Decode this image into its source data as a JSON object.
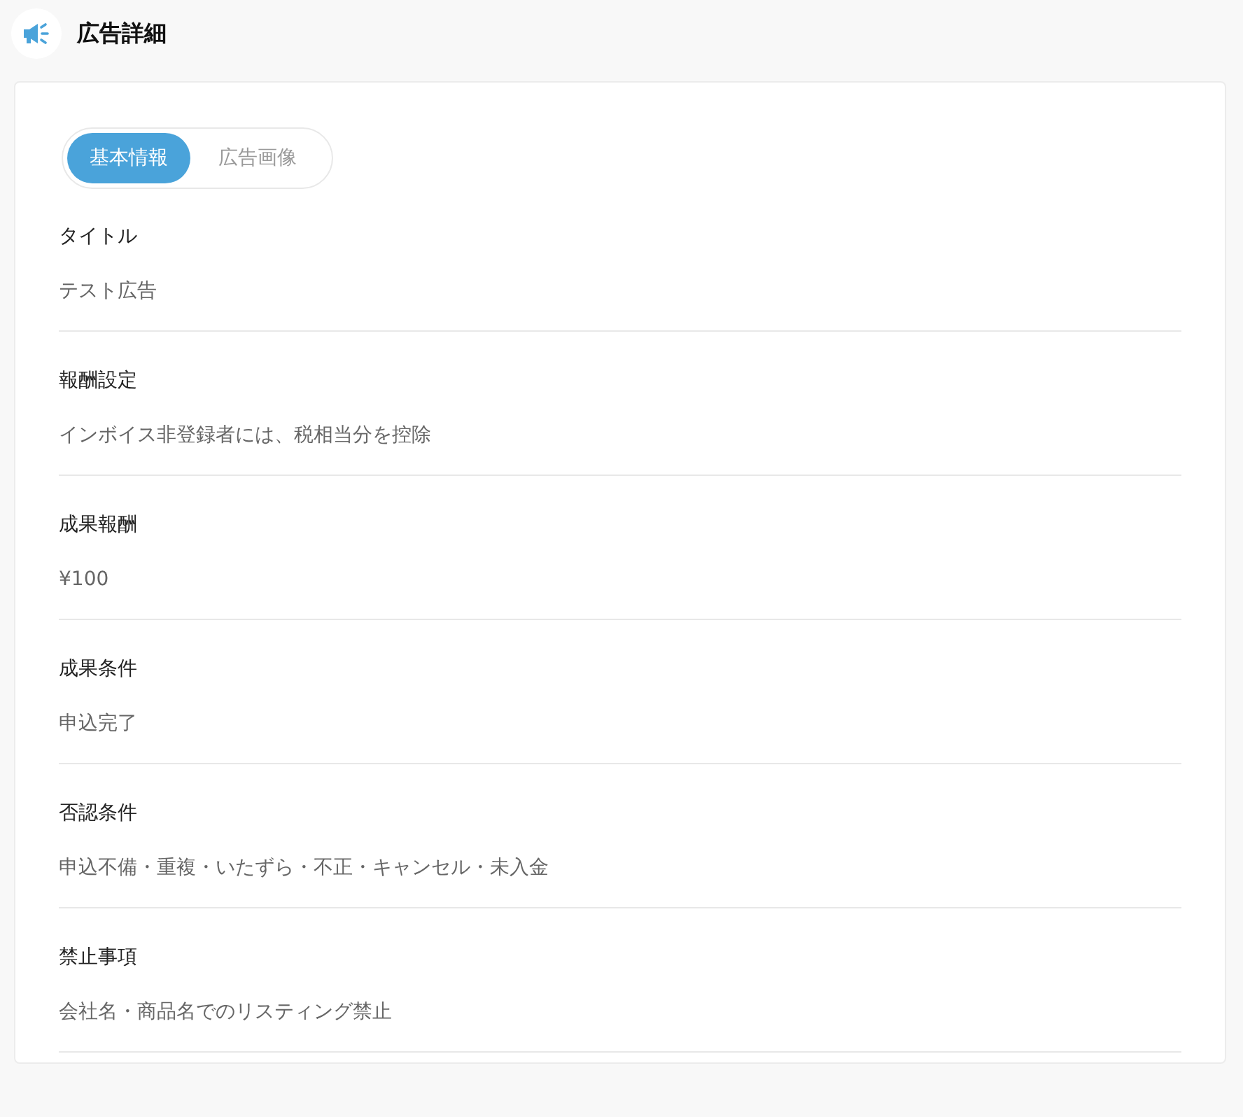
{
  "header": {
    "title": "広告詳細"
  },
  "tabs": [
    {
      "label": "基本情報",
      "selected": true
    },
    {
      "label": "広告画像",
      "selected": false
    }
  ],
  "fields": [
    {
      "label": "タイトル",
      "value": "テスト広告"
    },
    {
      "label": "報酬設定",
      "value": "インボイス非登録者には、税相当分を控除"
    },
    {
      "label": "成果報酬",
      "value": "¥100"
    },
    {
      "label": "成果条件",
      "value": "申込完了"
    },
    {
      "label": "否認条件",
      "value": "申込不備・重複・いたずら・不正・キャンセル・未入金"
    },
    {
      "label": "禁止事項",
      "value": "会社名・商品名でのリスティング禁止"
    }
  ]
}
